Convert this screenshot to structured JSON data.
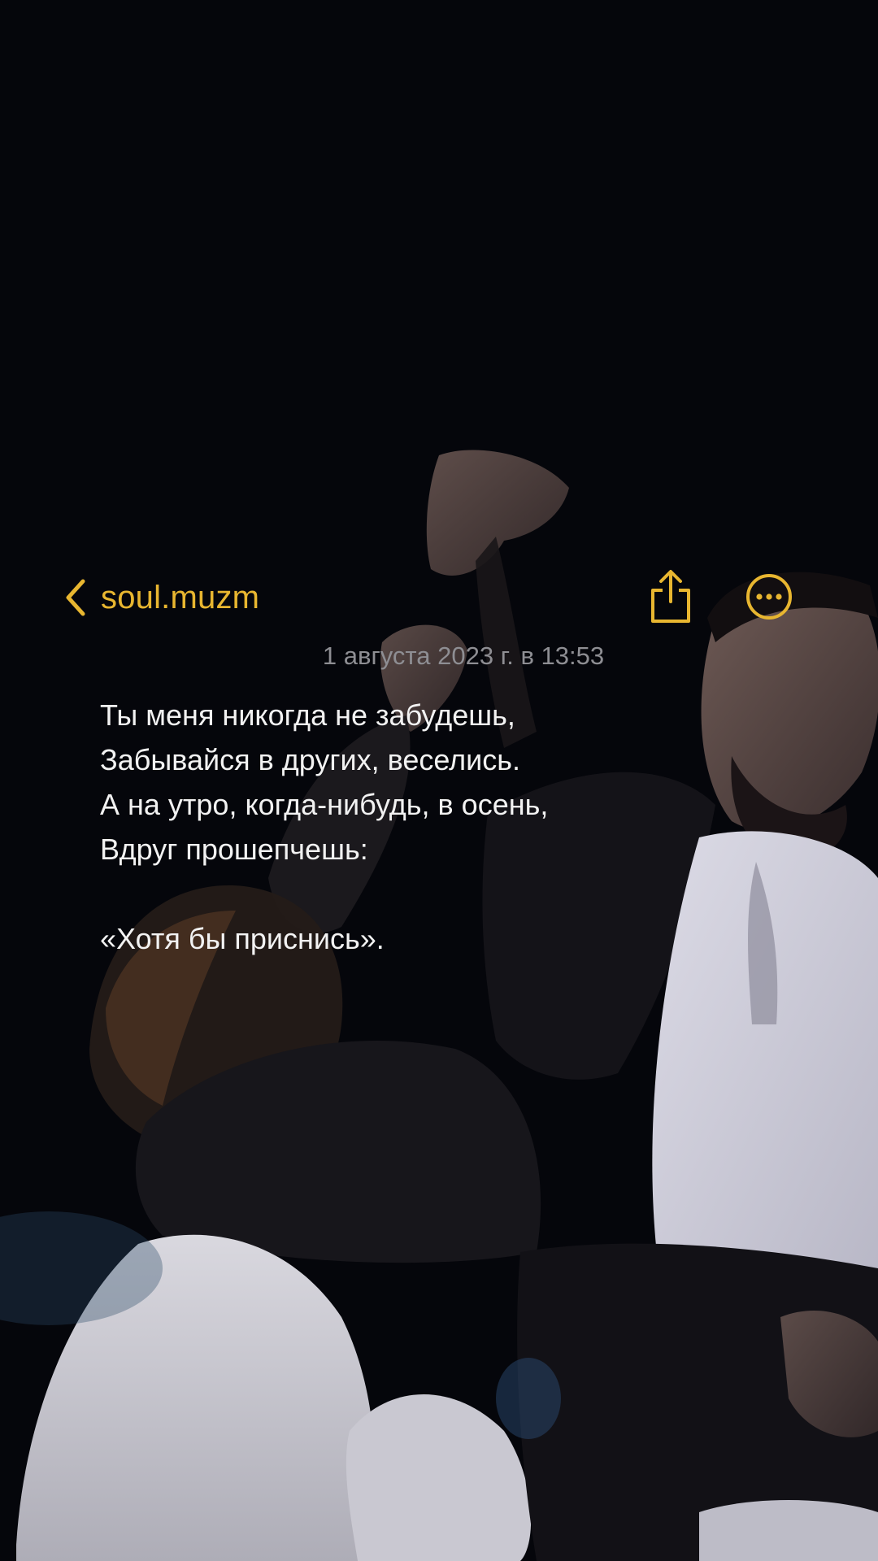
{
  "theme": {
    "accent": "#e8b630",
    "timestamp_color": "#8e8e93",
    "text_color": "#f2f2f2",
    "background": "#05060b"
  },
  "nav": {
    "back_label": "soul.muzm",
    "back_icon": "chevron-left-icon",
    "share_icon": "share-icon",
    "more_icon": "ellipsis-circle-icon"
  },
  "note": {
    "timestamp": "1 августа 2023 г. в 13:53",
    "lines": [
      "Ты меня никогда не забудешь,",
      "Забывайся в других, веселись.",
      "А на утро, когда-нибудь, в осень,",
      "Вдруг прошепчешь:",
      "",
      "«Хотя бы приснись»."
    ]
  }
}
